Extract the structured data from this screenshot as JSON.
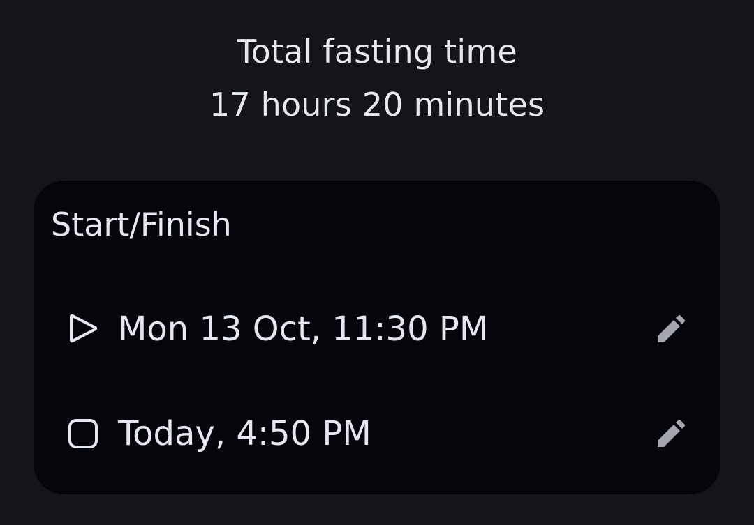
{
  "summary": {
    "title": "Total fasting time",
    "value": "17 hours 20 minutes"
  },
  "card": {
    "title": "Start/Finish",
    "rows": [
      {
        "icon": "play-icon",
        "label": "Mon 13 Oct, 11:30 PM",
        "action_icon": "pencil-icon"
      },
      {
        "icon": "stop-icon",
        "label": "Today, 4:50 PM",
        "action_icon": "pencil-icon"
      }
    ]
  },
  "colors": {
    "background": "#141519",
    "card": "#04060c",
    "text": "#e6e8ef",
    "edit_icon": "#a3a6ad"
  }
}
